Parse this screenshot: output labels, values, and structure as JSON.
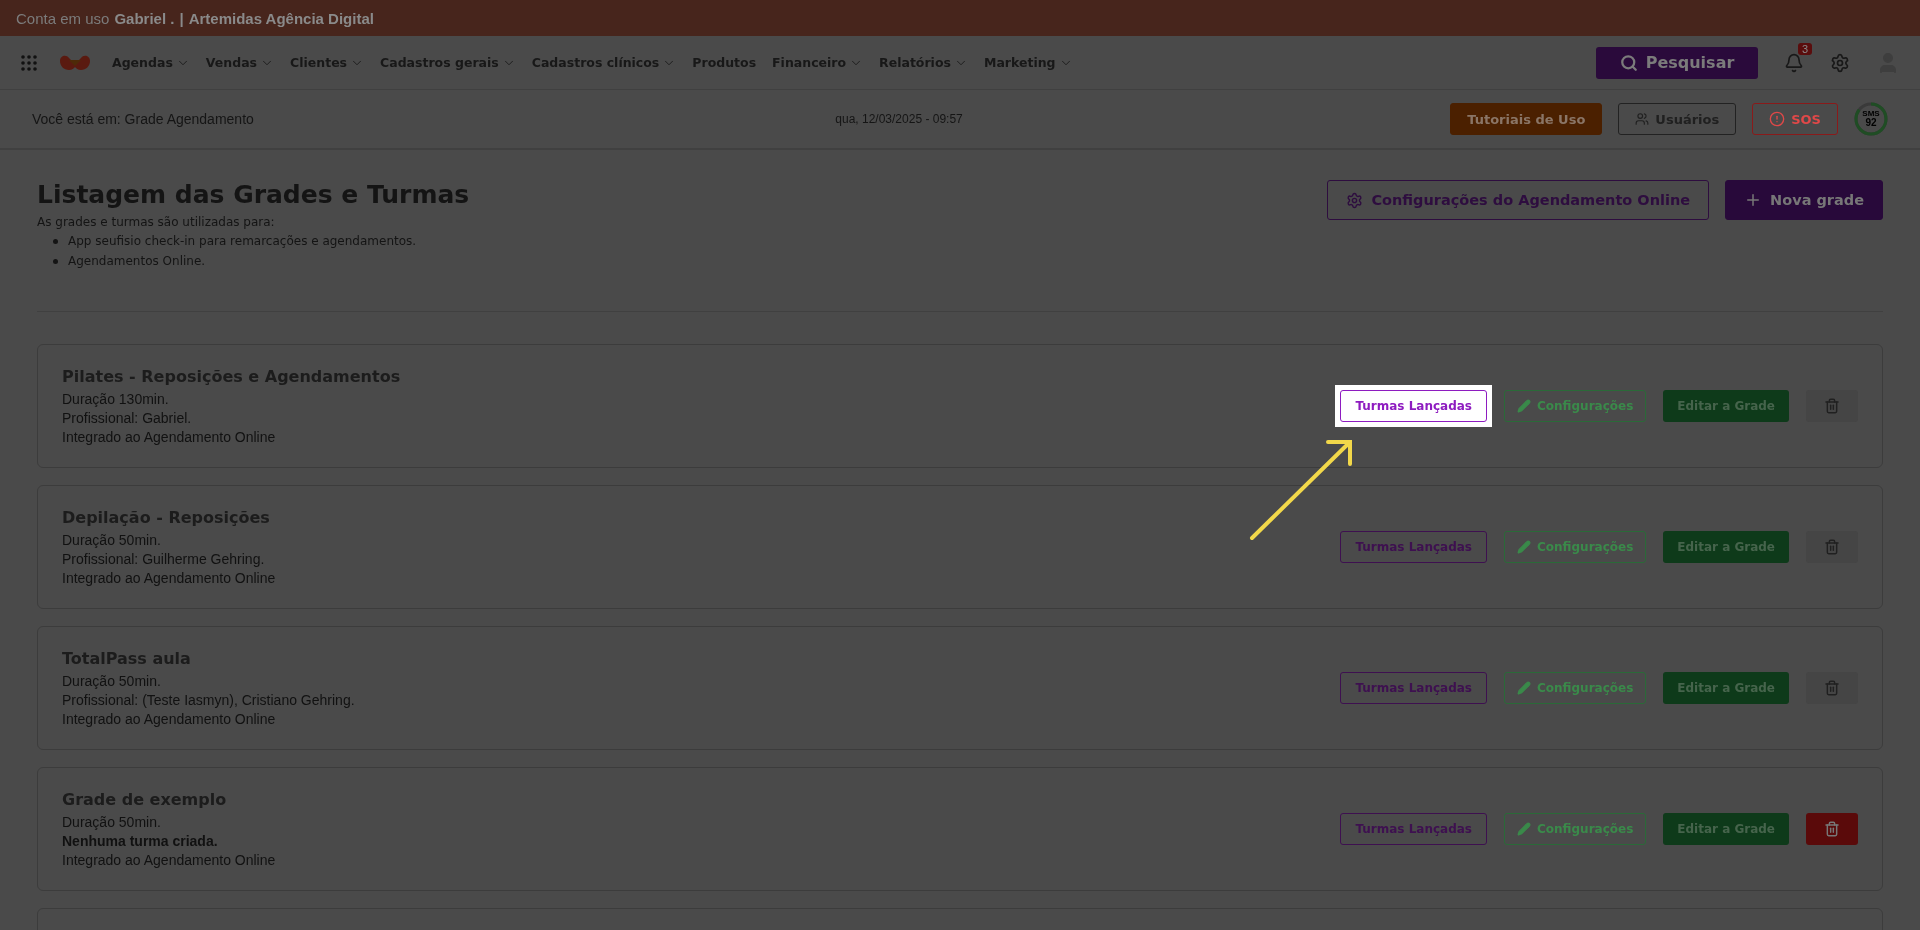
{
  "account_bar": {
    "prefix": "Conta em uso",
    "user": "Gabriel .",
    "separator": "|",
    "company": "Artemidas Agência Digital"
  },
  "nav": {
    "items": [
      {
        "label": "Agendas",
        "dropdown": true
      },
      {
        "label": "Vendas",
        "dropdown": true
      },
      {
        "label": "Clientes",
        "dropdown": true
      },
      {
        "label": "Cadastros gerais",
        "dropdown": true
      },
      {
        "label": "Cadastros clínicos",
        "dropdown": true
      },
      {
        "label": "Produtos",
        "dropdown": false
      },
      {
        "label": "Financeiro",
        "dropdown": true
      },
      {
        "label": "Relatórios",
        "dropdown": true
      },
      {
        "label": "Marketing",
        "dropdown": true
      }
    ],
    "search_button": "Pesquisar",
    "notifications_badge": "3"
  },
  "info_bar": {
    "breadcrumb": "Você está em: Grade Agendamento",
    "datetime": "qua, 12/03/2025 - 09:57",
    "buttons": [
      "Tutoriais de Uso",
      "Usuários",
      "SOS"
    ],
    "sms": {
      "label": "SMS",
      "count": "92",
      "level": 0.85
    }
  },
  "page": {
    "title": "Listagem das Grades e Turmas",
    "intro": "As grades e turmas são utilizadas para:",
    "bullets": [
      "App seufisio check-in para remarcações e agendamentos.",
      "Agendamentos Online."
    ],
    "online_settings_button": "Configurações do Agendamento Online",
    "new_button": "Nova grade"
  },
  "grades": [
    {
      "title": "Pilates - Reposições e Agendamentos",
      "lines": [
        {
          "text": "Duração 130min.",
          "bold": false
        },
        {
          "text": "Profissional: Gabriel.",
          "bold": false
        },
        {
          "text": "Integrado ao Agendamento Online",
          "bold": false
        }
      ],
      "classes_button": "Turmas Lançadas",
      "highlighted": true,
      "settings_button": "Configurações",
      "edit_button": "Editar a Grade",
      "delete_enabled": false
    },
    {
      "title": "Depilação - Reposições",
      "lines": [
        {
          "text": "Duração 50min.",
          "bold": false
        },
        {
          "text": "Profissional: Guilherme Gehring.",
          "bold": false
        },
        {
          "text": "Integrado ao Agendamento Online",
          "bold": false
        }
      ],
      "classes_button": "Turmas Lançadas",
      "highlighted": false,
      "settings_button": "Configurações",
      "edit_button": "Editar a Grade",
      "delete_enabled": false
    },
    {
      "title": "TotalPass aula",
      "lines": [
        {
          "text": "Duração 50min.",
          "bold": false
        },
        {
          "text": "Profissional: (Teste Iasmyn), Cristiano Gehring.",
          "bold": false
        },
        {
          "text": "Integrado ao Agendamento Online",
          "bold": false
        }
      ],
      "classes_button": "Turmas Lançadas",
      "highlighted": false,
      "settings_button": "Configurações",
      "edit_button": "Editar a Grade",
      "delete_enabled": false
    },
    {
      "title": "Grade de exemplo",
      "lines": [
        {
          "text": "Duração 50min.",
          "bold": false
        },
        {
          "text": "Nenhuma turma criada.",
          "bold": true
        },
        {
          "text": "Integrado ao Agendamento Online",
          "bold": false
        }
      ],
      "classes_button": "Turmas Lançadas",
      "highlighted": false,
      "settings_button": "Configurações",
      "edit_button": "Editar a Grade",
      "delete_enabled": true
    }
  ]
}
